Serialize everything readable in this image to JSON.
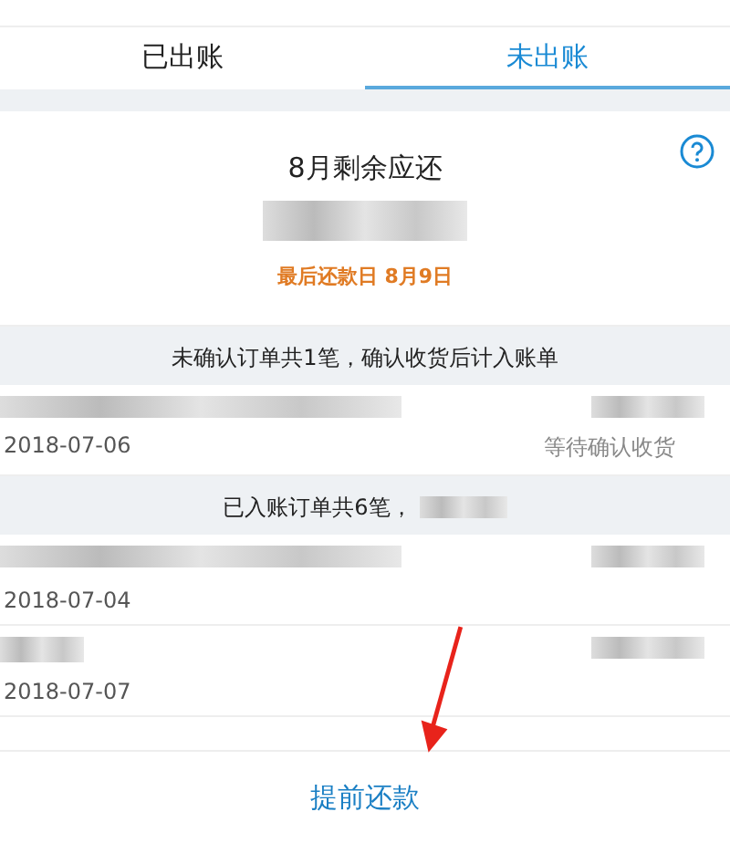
{
  "tabs": [
    {
      "label": "已出账",
      "selected": false
    },
    {
      "label": "未出账",
      "selected": true
    }
  ],
  "summary": {
    "title": "8月剩余应还",
    "due_date": "最后还款日 8月9日"
  },
  "unconfirmed": {
    "header": "未确认订单共1笔，确认收货后计入账单",
    "orders": [
      {
        "date": "2018-07-06",
        "status": "等待确认收货"
      }
    ]
  },
  "billed": {
    "header": "已入账订单共6笔，",
    "orders": [
      {
        "date": "2018-07-04"
      },
      {
        "date": "2018-07-07"
      }
    ]
  },
  "repay_button": "提前还款"
}
